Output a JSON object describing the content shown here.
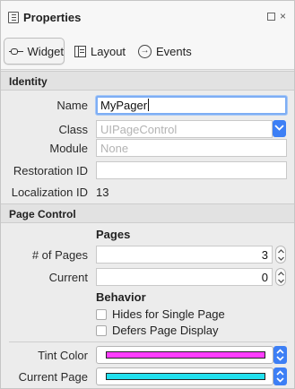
{
  "window": {
    "title": "Properties"
  },
  "tabs": [
    {
      "label": "Widget",
      "icon": "widget-icon",
      "active": true
    },
    {
      "label": "Layout",
      "icon": "layout-icon",
      "active": false
    },
    {
      "label": "Events",
      "icon": "events-icon",
      "active": false
    }
  ],
  "identity": {
    "header": "Identity",
    "name_label": "Name",
    "name_value": "MyPager",
    "class_label": "Class",
    "class_placeholder": "UIPageControl",
    "module_label": "Module",
    "module_placeholder": "None",
    "restoration_label": "Restoration ID",
    "restoration_value": "",
    "localization_label": "Localization ID",
    "localization_value": "13"
  },
  "page_control": {
    "header": "Page Control",
    "pages_heading": "Pages",
    "num_pages_label": "# of Pages",
    "num_pages_value": "3",
    "current_label": "Current",
    "current_value": "0",
    "behavior_heading": "Behavior",
    "hides_label": "Hides for Single Page",
    "hides_checked": false,
    "defers_label": "Defers Page Display",
    "defers_checked": false,
    "tint_label": "Tint Color",
    "tint_color": "#ff3dff",
    "current_page_label": "Current Page",
    "current_page_color": "#22e0ee"
  },
  "colors": {
    "accent": "#3d7ff5",
    "focus": "#7eaef4"
  }
}
